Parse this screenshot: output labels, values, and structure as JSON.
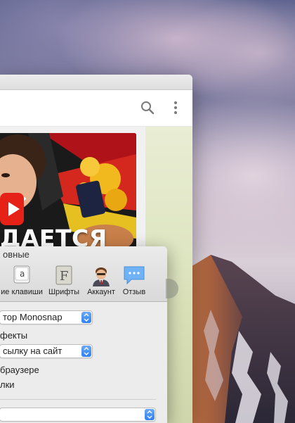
{
  "browser": {
    "thumbnail": {
      "headline": "ДАЕТСЯ"
    }
  },
  "preferences": {
    "window_title": "овные",
    "toolbar": [
      {
        "label": "ие клавиши",
        "icon": "keyboard-key-icon"
      },
      {
        "label": "Шрифты",
        "icon": "font-icon"
      },
      {
        "label": "Аккаунт",
        "icon": "account-avatar-icon"
      },
      {
        "label": "Отзыв",
        "icon": "speech-bubble-icon"
      }
    ],
    "editor_select": "тор Monosnap",
    "effects_label": "фекты",
    "upload_select": "сылку на сайт",
    "browser_label": "браузере",
    "links_label": "лки",
    "bottom_select": ""
  },
  "colors": {
    "stepper_blue": "#2f7ff0",
    "feedback_bubble": "#6fb2f5",
    "youtube_red": "#e62117"
  }
}
